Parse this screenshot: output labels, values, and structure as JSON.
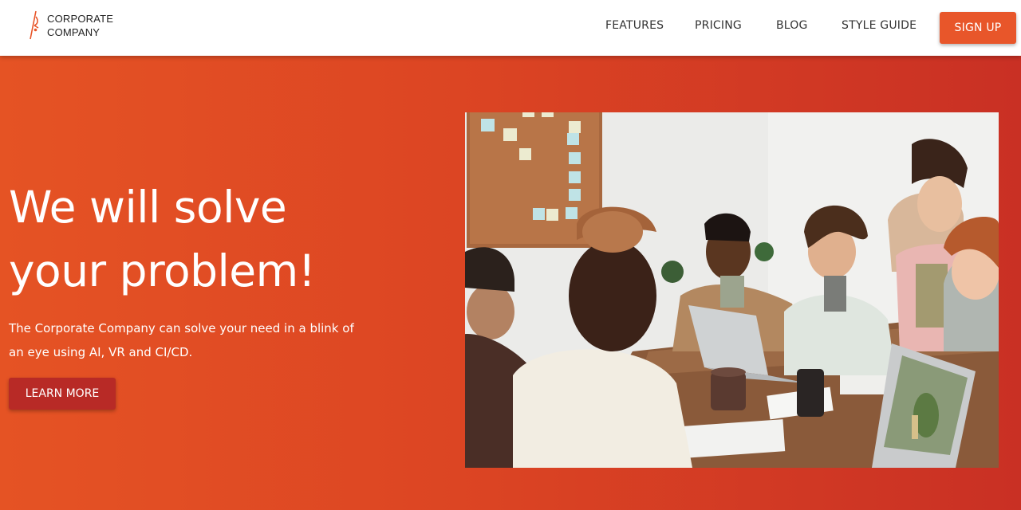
{
  "colors": {
    "accent": "#e8562a",
    "hero_start": "#e55324",
    "hero_end": "#c93024",
    "learn_more_bg": "#b82a26"
  },
  "nav": {
    "logo_icon": "logo-mark-icon",
    "logo_line1": "CORPORATE",
    "logo_line2": "COMPANY",
    "links": [
      "FEATURES",
      "PRICING",
      "BLOG",
      "STYLE GUIDE"
    ],
    "signup_label": "SIGN UP"
  },
  "hero": {
    "title_line1": "We will solve",
    "title_line2": "your problem!",
    "description": "The Corporate Company can solve your need in a blink of an eye using AI, VR and CI/CD.",
    "cta_label": "LEARN MORE"
  }
}
